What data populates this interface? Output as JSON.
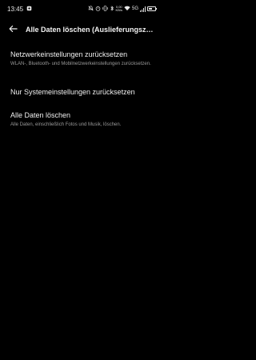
{
  "statusbar": {
    "time": "13:45",
    "network_label": "5G",
    "network_speed": "0,00",
    "network_unit": "KB/s",
    "battery_percent": 55,
    "icons": [
      "gallery-icon",
      "mute-icon",
      "alarm-icon",
      "vibrate-icon",
      "bluetooth-icon",
      "wifi-icon",
      "signal-icon",
      "battery-icon"
    ]
  },
  "header": {
    "title": "Alle Daten löschen (Auslieferungszust…"
  },
  "items": [
    {
      "title": "Netzwerkeinstellungen zurücksetzen",
      "description": "WLAN-, Bluetooth- und Mobilnetzwerkeinstellungen zurücksetzen."
    },
    {
      "title": "Nur Systemeinstellungen zurücksetzen",
      "description": ""
    },
    {
      "title": "Alle Daten löschen",
      "description": "Alle Daten, einschließlich Fotos und Musik, löschen."
    }
  ]
}
